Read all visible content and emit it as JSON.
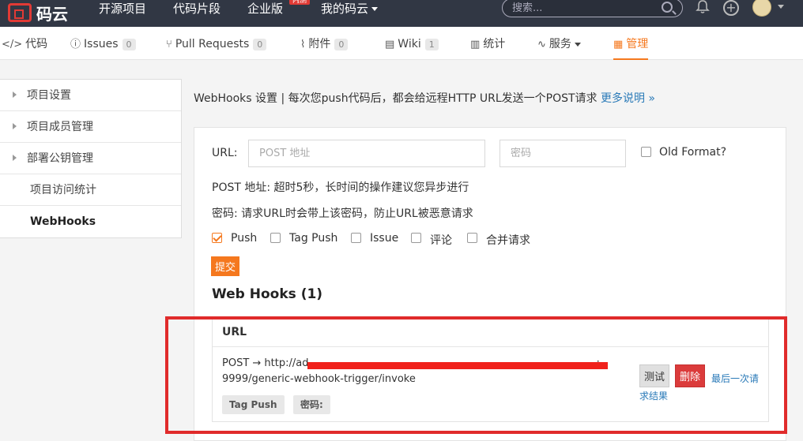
{
  "topbar": {
    "logo_text": "码云",
    "nav": [
      "开源项目",
      "代码片段",
      "企业版",
      "我的码云"
    ],
    "badge": "内测",
    "search_placeholder": "搜索..."
  },
  "tabs": [
    {
      "label": "代码",
      "icon": "code-icon"
    },
    {
      "label": "Issues",
      "count": "0",
      "icon": "issue-icon"
    },
    {
      "label": "Pull Requests",
      "count": "0",
      "icon": "pull-request-icon"
    },
    {
      "label": "附件",
      "count": "0",
      "icon": "paperclip-icon"
    },
    {
      "label": "Wiki",
      "count": "1",
      "icon": "book-icon"
    },
    {
      "label": "统计",
      "icon": "bar-chart-icon"
    },
    {
      "label": "服务",
      "icon": "pulse-icon"
    },
    {
      "label": "管理",
      "icon": "manage-icon"
    }
  ],
  "sidebar": {
    "items": [
      "项目设置",
      "项目成员管理",
      "部署公钥管理",
      "项目访问统计",
      "WebHooks"
    ]
  },
  "main": {
    "description": "WebHooks 设置 | 每次您push代码后，都会给远程HTTP URL发送一个POST请求",
    "more_link": "更多说明 »",
    "form": {
      "url_label": "URL:",
      "url_placeholder": "POST 地址",
      "password_placeholder": "密码",
      "old_format_label": "Old Format?",
      "note_post": "POST 地址: 超时5秒，长时间的操作建议您异步进行",
      "note_password": "密码: 请求URL时会带上该密码，防止URL被恶意请求",
      "events": [
        {
          "label": "Push",
          "checked": true
        },
        {
          "label": "Tag Push",
          "checked": false
        },
        {
          "label": "Issue",
          "checked": false
        },
        {
          "label": "评论",
          "checked": false
        },
        {
          "label": "合并请求",
          "checked": false
        }
      ],
      "submit_label": "提交"
    },
    "hooks_title": "Web Hooks (1)",
    "hooks_table": {
      "header": "URL",
      "row": {
        "url_line1": "POST → http://ad",
        "url_line1_end": ":",
        "url_line2": "9999/generic-webhook-trigger/invoke",
        "tags": [
          "Tag Push",
          "密码:"
        ],
        "test_label": "测试",
        "delete_label": "删除",
        "last_result_label": "最后一次请求结果"
      }
    }
  },
  "colors": {
    "accent": "#f5781e",
    "topbar": "#313744",
    "danger": "#db3b3b",
    "link": "#2a7ab8",
    "highlight": "#e02b2b"
  }
}
